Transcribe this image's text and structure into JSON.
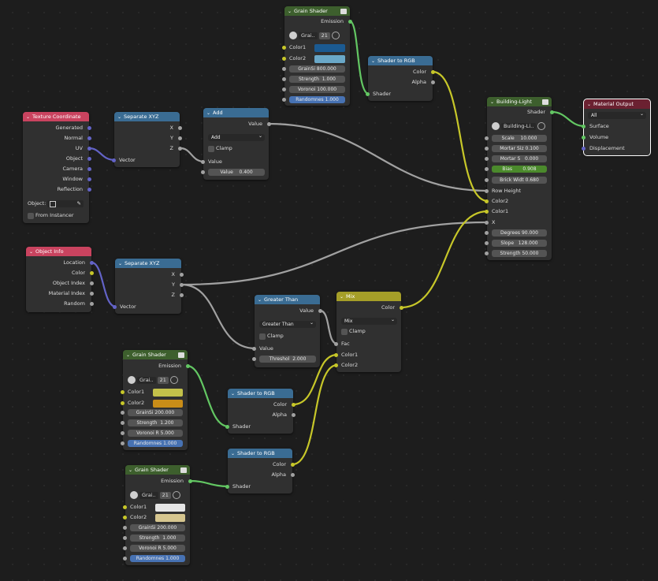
{
  "nodes": {
    "tex_coord": {
      "title": "Texture Coordinate",
      "outputs": [
        "Generated",
        "Normal",
        "UV",
        "Object",
        "Camera",
        "Window",
        "Reflection"
      ],
      "object_label": "Object:",
      "from_instancer": "From Instancer"
    },
    "sep_xyz_1": {
      "title": "Separate XYZ",
      "outputs": [
        "X",
        "Y",
        "Z"
      ],
      "input": "Vector"
    },
    "add": {
      "title": "Add",
      "output": "Value",
      "operation": "Add",
      "clamp": "Clamp",
      "input": "Value",
      "value_label": "Value",
      "value": "0.400"
    },
    "grain_top": {
      "title": "Grain Shader",
      "output": "Emission",
      "group_name": "Grai..",
      "users": "21",
      "color1": "Color1",
      "color2": "Color2",
      "color1_hex": "#1b5a91",
      "color2_hex": "#6aa8c8",
      "grain_label": "GrainSi",
      "grain": "800.000",
      "strength_label": "Strength",
      "strength": "1.000",
      "voronoi_label": "Voronoi",
      "voronoi": "100.000",
      "random_label": "Randomnes",
      "random": "1.000"
    },
    "s2rgb_top": {
      "title": "Shader to RGB",
      "outputs": [
        "Color",
        "Alpha"
      ],
      "input": "Shader"
    },
    "building": {
      "title": "Building-Light",
      "output": "Shader",
      "group_name": "Building-Li..",
      "scale_label": "Scale",
      "scale": "10.000",
      "mortar_sz_label": "Mortar Siz",
      "mortar_sz": "0.100",
      "mortar_s_label": "Mortar S",
      "mortar_s": "0.000",
      "bias_label": "Bias",
      "bias": "0.908",
      "brick_w_label": "Brick Widt",
      "brick_w": "0.680",
      "row_height": "Row Height",
      "color2": "Color2",
      "color1": "Color1",
      "x": "X",
      "degrees_label": "Degrees",
      "degrees": "90.000",
      "slope_label": "Slope",
      "slope": "128.000",
      "strength_label": "Strength",
      "strength": "50.000"
    },
    "mat_out": {
      "title": "Material Output",
      "target": "All",
      "inputs": [
        "Surface",
        "Volume",
        "Displacement"
      ]
    },
    "obj_info": {
      "title": "Object Info",
      "outputs": [
        "Location",
        "Color",
        "Object Index",
        "Material Index",
        "Random"
      ]
    },
    "sep_xyz_2": {
      "title": "Separate XYZ",
      "outputs": [
        "X",
        "Y",
        "Z"
      ],
      "input": "Vector"
    },
    "greater": {
      "title": "Greater Than",
      "output": "Value",
      "operation": "Greater Than",
      "clamp": "Clamp",
      "input": "Value",
      "thresh_label": "Threshol",
      "thresh": "2.000"
    },
    "mix": {
      "title": "Mix",
      "output": "Color",
      "blend": "Mix",
      "clamp": "Clamp",
      "fac": "Fac",
      "color1": "Color1",
      "color2": "Color2"
    },
    "grain_mid": {
      "title": "Grain Shader",
      "output": "Emission",
      "group_name": "Grai..",
      "users": "21",
      "color1": "Color1",
      "color2": "Color2",
      "color1_hex": "#c3c14a",
      "color2_hex": "#c98d18",
      "grain_label": "GrainSi",
      "grain": "200.000",
      "strength_label": "Strength",
      "strength": "1.200",
      "voronoi_label": "Voronoi R",
      "voronoi": "5.000",
      "random_label": "Randomnes",
      "random": "1.000"
    },
    "s2rgb_mid": {
      "title": "Shader to RGB",
      "outputs": [
        "Color",
        "Alpha"
      ],
      "input": "Shader"
    },
    "s2rgb_bot": {
      "title": "Shader to RGB",
      "outputs": [
        "Color",
        "Alpha"
      ],
      "input": "Shader"
    },
    "grain_bot": {
      "title": "Grain Shader",
      "output": "Emission",
      "group_name": "Grai..",
      "users": "21",
      "color1": "Color1",
      "color2": "Color2",
      "color1_hex": "#e6e6e6",
      "color2_hex": "#d6c68f",
      "grain_label": "GrainSi",
      "grain": "200.000",
      "strength_label": "Strength",
      "strength": "1.000",
      "voronoi_label": "Voronoi R",
      "voronoi": "5.000",
      "random_label": "Randomnes",
      "random": "1.000"
    }
  },
  "colors": {
    "vector": "#6363c7",
    "float": "#a1a1a1",
    "color": "#c7c729",
    "shader": "#63c763"
  }
}
